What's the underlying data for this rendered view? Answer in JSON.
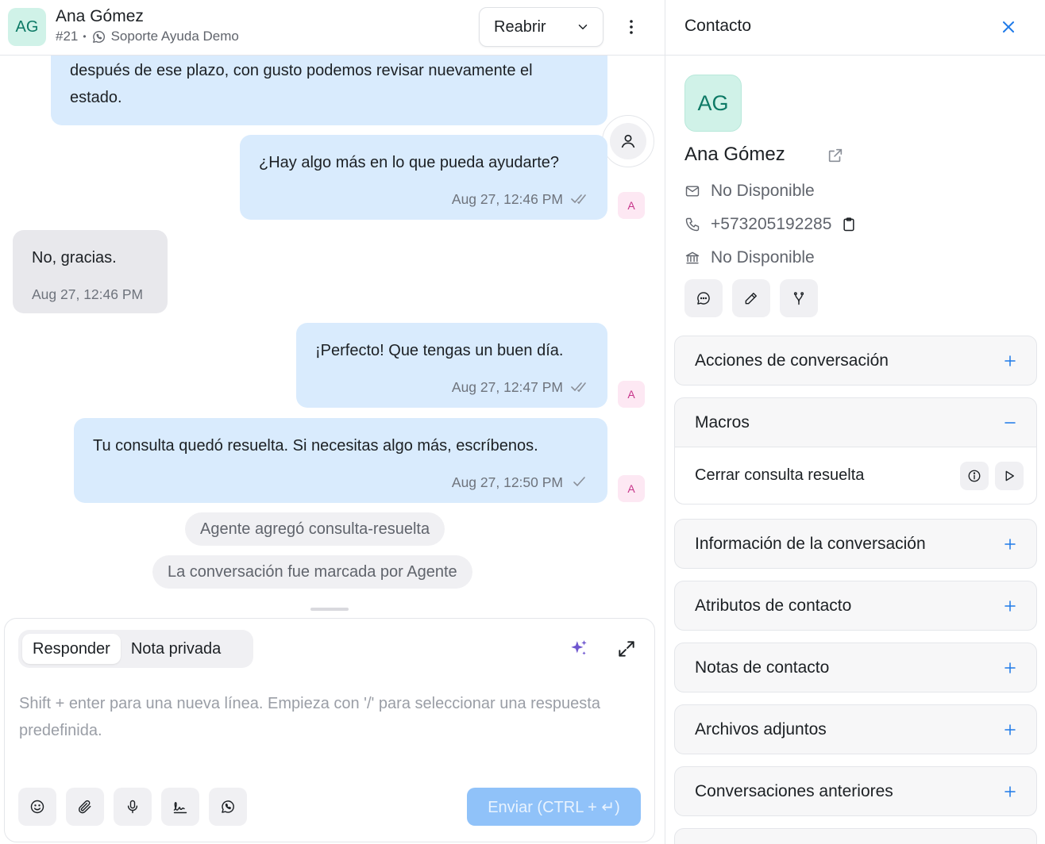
{
  "conversation": {
    "contact_initials": "AG",
    "contact_name": "Ana Gómez",
    "id": "#21",
    "inbox": "Soporte Ayuda Demo",
    "reopen_label": "Reabrir"
  },
  "messages": [
    {
      "direction": "outgoing",
      "text": "después de ese plazo, con gusto podemos revisar nuevamente el estado.",
      "time": "",
      "sender": ""
    },
    {
      "direction": "outgoing",
      "text": "¿Hay algo más en lo que pueda ayudarte?",
      "time": "Aug 27, 12:46 PM",
      "sender": "A",
      "status": "read"
    },
    {
      "direction": "incoming",
      "text": "No, gracias.",
      "time": "Aug 27, 12:46 PM"
    },
    {
      "direction": "outgoing",
      "text": "¡Perfecto! Que tengas un buen día.",
      "time": "Aug 27, 12:47 PM",
      "sender": "A",
      "status": "read"
    },
    {
      "direction": "outgoing",
      "text": "Tu consulta quedó resuelta. Si necesitas algo más, escríbenos.",
      "time": "Aug 27, 12:50 PM",
      "sender": "A",
      "status": "sent"
    }
  ],
  "activities": [
    "Agente agregó consulta-resuelta",
    "La conversación fue marcada por Agente"
  ],
  "editor": {
    "reply_tab": "Responder",
    "private_note_tab": "Nota privada",
    "placeholder": "Shift + enter para una nueva línea. Empieza con '/' para seleccionar una respuesta predefinida.",
    "send_label": "Enviar (CTRL + ↵)",
    "tool_icons": [
      "emoji-icon",
      "attachment-icon",
      "microphone-icon",
      "signature-icon",
      "whatsapp-icon"
    ]
  },
  "contact_panel": {
    "title": "Contacto",
    "initials": "AG",
    "name": "Ana Gómez",
    "email": "No Disponible",
    "phone": "+573205192285",
    "company": "No Disponible"
  },
  "sections": {
    "conversation_actions": "Acciones de conversación",
    "macros": "Macros",
    "macro_item": "Cerrar consulta resuelta",
    "conversation_info": "Información de la conversación",
    "contact_attributes": "Atributos de contacto",
    "contact_notes": "Notas de contacto",
    "attachments": "Archivos adjuntos",
    "previous_conversations": "Conversaciones anteriores"
  },
  "colors": {
    "outgoing_bubble": "#d9ebfd",
    "incoming_bubble": "#e8e8ec",
    "accent": "#1f7ae8",
    "send_button": "#90c2f9",
    "avatar_bg": "#d0f2e8"
  }
}
